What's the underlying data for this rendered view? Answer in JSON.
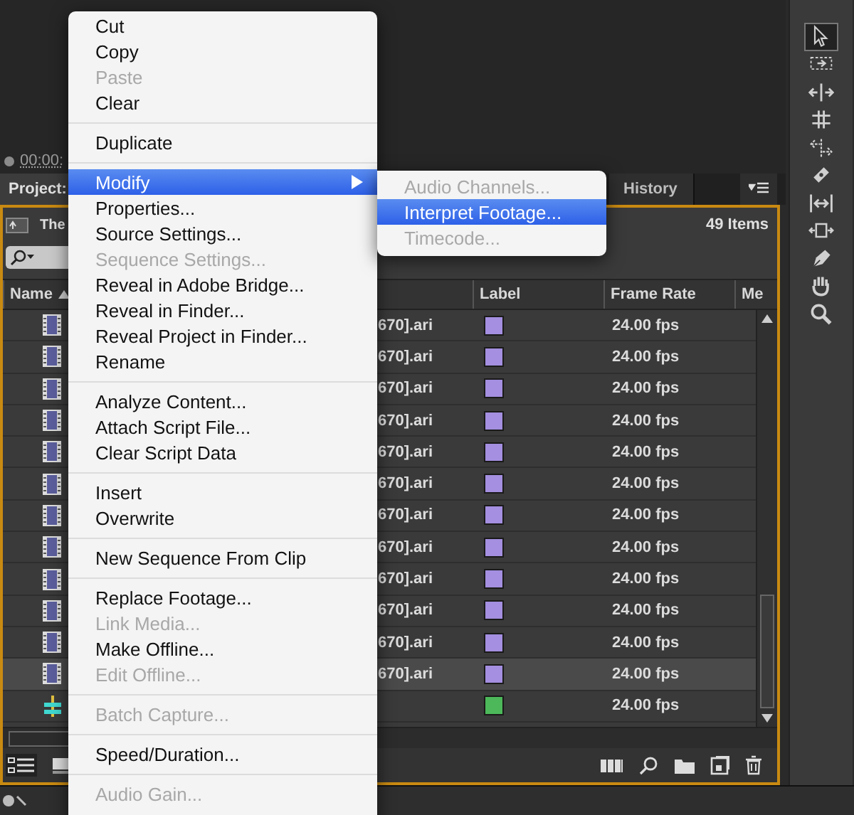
{
  "viewer": {
    "timecode": "00:00:"
  },
  "panel": {
    "tabs": [
      {
        "label": "Project:",
        "selected": true
      },
      {
        "label": "History",
        "selected": false
      }
    ],
    "bin_name": "The",
    "item_count": "49 Items",
    "table": {
      "columns": [
        "Name",
        "Label",
        "Frame Rate",
        "Me"
      ],
      "rows": [
        {
          "kind": "clip",
          "name": "670].ari",
          "color": "#a48fe0",
          "frame_rate": "24.00 fps",
          "selected": false
        },
        {
          "kind": "clip",
          "name": "670].ari",
          "color": "#a48fe0",
          "frame_rate": "24.00 fps",
          "selected": false
        },
        {
          "kind": "clip",
          "name": "670].ari",
          "color": "#a48fe0",
          "frame_rate": "24.00 fps",
          "selected": false
        },
        {
          "kind": "clip",
          "name": "670].ari",
          "color": "#a48fe0",
          "frame_rate": "24.00 fps",
          "selected": false
        },
        {
          "kind": "clip",
          "name": "670].ari",
          "color": "#a48fe0",
          "frame_rate": "24.00 fps",
          "selected": false
        },
        {
          "kind": "clip",
          "name": "670].ari",
          "color": "#a48fe0",
          "frame_rate": "24.00 fps",
          "selected": false
        },
        {
          "kind": "clip",
          "name": "670].ari",
          "color": "#a48fe0",
          "frame_rate": "24.00 fps",
          "selected": false
        },
        {
          "kind": "clip",
          "name": "670].ari",
          "color": "#a48fe0",
          "frame_rate": "24.00 fps",
          "selected": false
        },
        {
          "kind": "clip",
          "name": "670].ari",
          "color": "#a48fe0",
          "frame_rate": "24.00 fps",
          "selected": false
        },
        {
          "kind": "clip",
          "name": "670].ari",
          "color": "#a48fe0",
          "frame_rate": "24.00 fps",
          "selected": false
        },
        {
          "kind": "clip",
          "name": "670].ari",
          "color": "#a48fe0",
          "frame_rate": "24.00 fps",
          "selected": false
        },
        {
          "kind": "clip",
          "name": "670].ari",
          "color": "#a48fe0",
          "frame_rate": "24.00 fps",
          "selected": true
        },
        {
          "kind": "sequence",
          "name": "",
          "color": "#4cb85a",
          "frame_rate": "24.00 fps",
          "selected": false
        }
      ]
    }
  },
  "tools": [
    {
      "kind": "selection",
      "selected": true
    },
    {
      "kind": "track-select",
      "selected": false
    },
    {
      "kind": "ripple",
      "selected": false
    },
    {
      "kind": "rolling",
      "selected": false
    },
    {
      "kind": "rate-stretch",
      "selected": false
    },
    {
      "kind": "razor",
      "selected": false
    },
    {
      "kind": "slip",
      "selected": false
    },
    {
      "kind": "slide",
      "selected": false
    },
    {
      "kind": "pen",
      "selected": false
    },
    {
      "kind": "hand",
      "selected": false
    },
    {
      "kind": "zoom",
      "selected": false
    }
  ],
  "context_menu": {
    "items": [
      {
        "kind": "item",
        "label": "Cut",
        "disabled": false,
        "selected": false
      },
      {
        "kind": "item",
        "label": "Copy",
        "disabled": false,
        "selected": false
      },
      {
        "kind": "item",
        "label": "Paste",
        "disabled": true,
        "selected": false
      },
      {
        "kind": "item",
        "label": "Clear",
        "disabled": false,
        "selected": false
      },
      {
        "kind": "separator"
      },
      {
        "kind": "item",
        "label": "Duplicate",
        "disabled": false,
        "selected": false
      },
      {
        "kind": "separator"
      },
      {
        "kind": "submenu",
        "label": "Modify",
        "disabled": false,
        "selected": true
      },
      {
        "kind": "item",
        "label": "Properties...",
        "disabled": false,
        "selected": false
      },
      {
        "kind": "item",
        "label": "Source Settings...",
        "disabled": false,
        "selected": false
      },
      {
        "kind": "item",
        "label": "Sequence Settings...",
        "disabled": true,
        "selected": false
      },
      {
        "kind": "item",
        "label": "Reveal in Adobe Bridge...",
        "disabled": false,
        "selected": false
      },
      {
        "kind": "item",
        "label": "Reveal in Finder...",
        "disabled": false,
        "selected": false
      },
      {
        "kind": "item",
        "label": "Reveal Project in Finder...",
        "disabled": false,
        "selected": false
      },
      {
        "kind": "item",
        "label": "Rename",
        "disabled": false,
        "selected": false
      },
      {
        "kind": "separator"
      },
      {
        "kind": "item",
        "label": "Analyze Content...",
        "disabled": false,
        "selected": false
      },
      {
        "kind": "item",
        "label": "Attach Script File...",
        "disabled": false,
        "selected": false
      },
      {
        "kind": "item",
        "label": "Clear Script Data",
        "disabled": false,
        "selected": false
      },
      {
        "kind": "separator"
      },
      {
        "kind": "item",
        "label": "Insert",
        "disabled": false,
        "selected": false
      },
      {
        "kind": "item",
        "label": "Overwrite",
        "disabled": false,
        "selected": false
      },
      {
        "kind": "separator"
      },
      {
        "kind": "item",
        "label": "New Sequence From Clip",
        "disabled": false,
        "selected": false
      },
      {
        "kind": "separator"
      },
      {
        "kind": "item",
        "label": "Replace Footage...",
        "disabled": false,
        "selected": false
      },
      {
        "kind": "item",
        "label": "Link Media...",
        "disabled": true,
        "selected": false
      },
      {
        "kind": "item",
        "label": "Make Offline...",
        "disabled": false,
        "selected": false
      },
      {
        "kind": "item",
        "label": "Edit Offline...",
        "disabled": true,
        "selected": false
      },
      {
        "kind": "separator"
      },
      {
        "kind": "item",
        "label": "Batch Capture...",
        "disabled": true,
        "selected": false
      },
      {
        "kind": "separator"
      },
      {
        "kind": "item",
        "label": "Speed/Duration...",
        "disabled": false,
        "selected": false
      },
      {
        "kind": "separator"
      },
      {
        "kind": "item",
        "label": "Audio Gain...",
        "disabled": true,
        "selected": false
      }
    ]
  },
  "submenu": {
    "items": [
      {
        "label": "Audio Channels...",
        "disabled": true,
        "selected": false
      },
      {
        "label": "Interpret Footage...",
        "disabled": false,
        "selected": true
      },
      {
        "label": "Timecode...",
        "disabled": true,
        "selected": false
      }
    ]
  }
}
